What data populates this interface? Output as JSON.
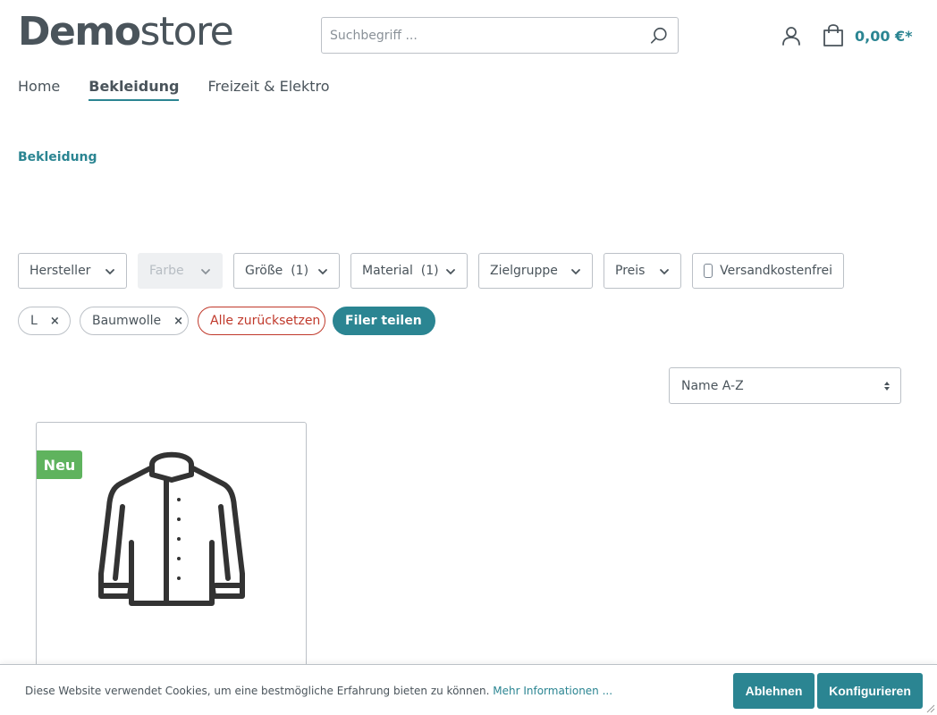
{
  "header": {
    "logo_bold": "Demo",
    "logo_light": "store",
    "search_placeholder": "Suchbegriff ...",
    "cart_total": "0,00 €*"
  },
  "nav": {
    "items": [
      {
        "label": "Home"
      },
      {
        "label": "Bekleidung",
        "active": true
      },
      {
        "label": "Freizeit & Elektro"
      }
    ]
  },
  "breadcrumb": "Bekleidung",
  "filters": {
    "manufacturer": "Hersteller",
    "color": "Farbe",
    "size": "Größe  (1)",
    "material": "Material  (1)",
    "target_group": "Zielgruppe",
    "price": "Preis",
    "free_shipping": "Versandkostenfrei"
  },
  "active_filters": {
    "size_value": "L",
    "material_value": "Baumwolle",
    "remove_icon": "×",
    "reset_label": "Alle zurücksetzen",
    "share_label": "Filer teilen"
  },
  "sorting": {
    "selected": "Name A-Z"
  },
  "product": {
    "badge": "Neu"
  },
  "cookie": {
    "message": "Diese Website verwendet Cookies, um eine bestmögliche Erfahrung bieten zu können. ",
    "more_link": "Mehr Informationen ...",
    "decline_label": "Ablehnen",
    "configure_label": "Konfigurieren"
  },
  "colors": {
    "accent": "#2b8592",
    "text": "#4a545b",
    "badge_new": "#5fb35e",
    "reset": "#c0392b"
  }
}
